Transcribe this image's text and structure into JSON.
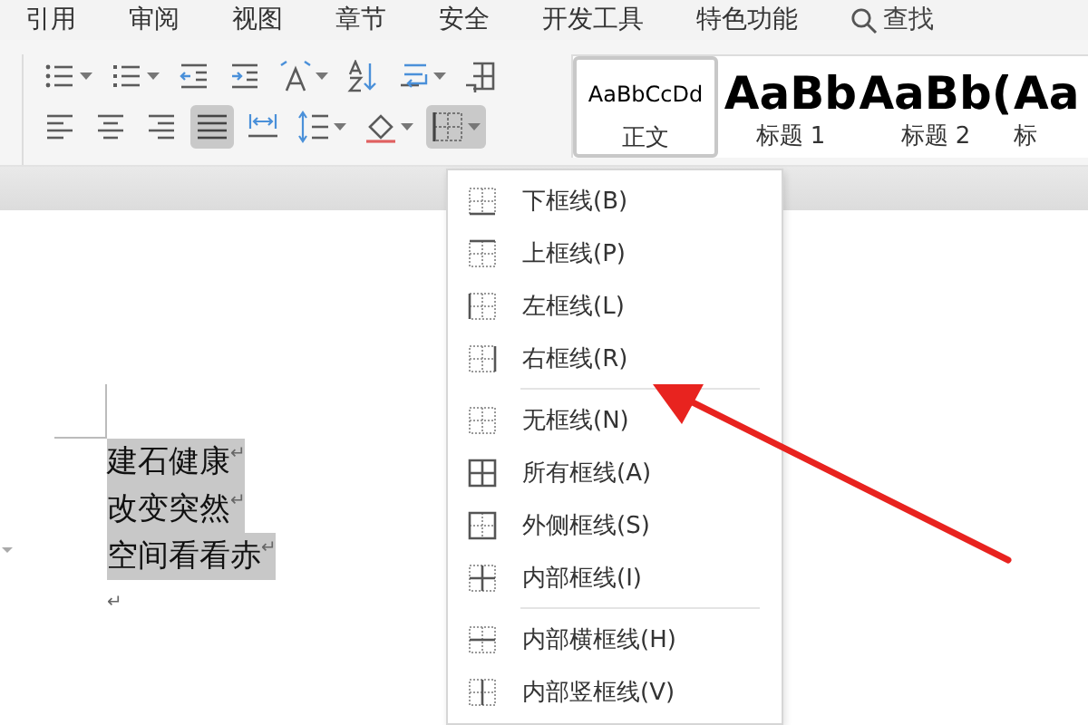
{
  "menu_tabs": [
    {
      "label": "引用"
    },
    {
      "label": "审阅"
    },
    {
      "label": "视图"
    },
    {
      "label": "章节"
    },
    {
      "label": "安全"
    },
    {
      "label": "开发工具"
    },
    {
      "label": "特色功能"
    }
  ],
  "search": {
    "label": "查找"
  },
  "toolbar_rows": [
    [
      {
        "kind": "bullets",
        "dropdown": true,
        "selected": false
      },
      {
        "kind": "numbering",
        "dropdown": true,
        "selected": false
      },
      {
        "kind": "outdent",
        "dropdown": false,
        "selected": false
      },
      {
        "kind": "indent",
        "dropdown": false,
        "selected": false
      },
      {
        "kind": "text-direction",
        "dropdown": true,
        "selected": false
      },
      {
        "kind": "sort",
        "dropdown": false,
        "selected": false
      },
      {
        "kind": "wrap",
        "dropdown": true,
        "selected": false
      },
      {
        "kind": "table",
        "dropdown": false,
        "selected": false
      }
    ],
    [
      {
        "kind": "align-left",
        "dropdown": false,
        "selected": false
      },
      {
        "kind": "align-center",
        "dropdown": false,
        "selected": false
      },
      {
        "kind": "align-right",
        "dropdown": false,
        "selected": false
      },
      {
        "kind": "justify",
        "dropdown": false,
        "selected": true
      },
      {
        "kind": "distribute",
        "dropdown": false,
        "selected": false
      },
      {
        "kind": "line-spacing",
        "dropdown": true,
        "selected": false
      },
      {
        "kind": "shading",
        "dropdown": true,
        "selected": false
      },
      {
        "kind": "borders",
        "dropdown": true,
        "selected": true
      }
    ]
  ],
  "styles": [
    {
      "kind": "body",
      "sample": "AaBbCcDd",
      "label": "正文",
      "selected": true
    },
    {
      "kind": "heading",
      "sample": "AaBb",
      "label": "标题 1",
      "selected": false
    },
    {
      "kind": "heading",
      "sample": "AaBb(",
      "label": "标题 2",
      "selected": false
    },
    {
      "kind": "heading",
      "sample": "Aa",
      "label": "标",
      "selected": false
    }
  ],
  "document": {
    "paragraphs": [
      {
        "text": "建石健康",
        "mark": "↵",
        "selected": true
      },
      {
        "text": "改变突然",
        "mark": "↵",
        "selected": true
      },
      {
        "text": "空间看看赤",
        "mark": "↵",
        "selected": true
      },
      {
        "mark": "↵",
        "selected": false
      }
    ]
  },
  "border_menu": {
    "groups": [
      [
        {
          "kind": "bottom",
          "label": "下框线(B)"
        },
        {
          "kind": "top",
          "label": "上框线(P)"
        },
        {
          "kind": "left",
          "label": "左框线(L)"
        },
        {
          "kind": "right",
          "label": "右框线(R)"
        }
      ],
      [
        {
          "kind": "none",
          "label": "无框线(N)"
        },
        {
          "kind": "all",
          "label": "所有框线(A)"
        },
        {
          "kind": "outside",
          "label": "外侧框线(S)"
        },
        {
          "kind": "inside",
          "label": "内部框线(I)"
        }
      ],
      [
        {
          "kind": "inside-h",
          "label": "内部横框线(H)"
        },
        {
          "kind": "inside-v",
          "label": "内部竖框线(V)"
        }
      ]
    ]
  }
}
